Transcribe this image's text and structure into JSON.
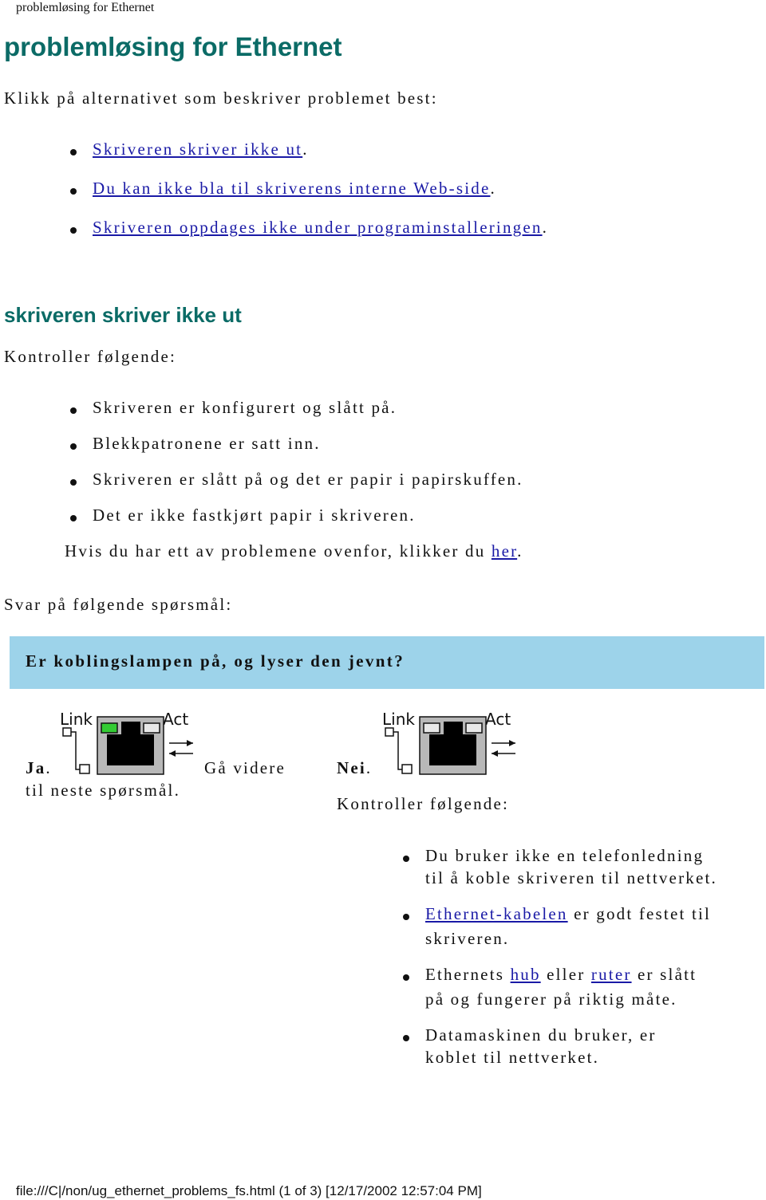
{
  "page_header": "problemløsing for Ethernet",
  "title": "problemløsing for Ethernet",
  "intro": "Klikk på alternativet som beskriver problemet best:",
  "problem_links": [
    {
      "label": "Skriveren skriver ikke ut",
      "suffix": "."
    },
    {
      "label": "Du kan ikke bla til skriverens interne Web-side",
      "suffix": "."
    },
    {
      "label": "Skriveren oppdages ikke under programinstalleringen",
      "suffix": "."
    }
  ],
  "section1": {
    "heading": "skriveren skriver ikke ut",
    "check_intro": "Kontroller følgende:",
    "checks": [
      "Skriveren er konfigurert og slått på.",
      "Blekkpatronene er satt inn.",
      "Skriveren er slått på og det er papir i papirskuffen.",
      "Det er ikke fastkjørt papir i skriveren."
    ],
    "help_prefix": "Hvis du har ett av problemene ovenfor, klikker du ",
    "help_link": "her",
    "help_suffix": ".",
    "answer_prompt": "Svar på følgende spørsmål:",
    "question": "Er koblingslampen på, og lyser den jevnt?"
  },
  "yes_answer": {
    "label": "Ja",
    "label_suffix": ".",
    "text_line1": "Gå videre",
    "text_line2": "til neste spørsmål.",
    "icon": {
      "name": "ethernet-port-link-on-icon",
      "link_label": "Link",
      "act_label": "Act",
      "link_led_color": "#33cc33",
      "act_led_color": "#e8e8e8"
    }
  },
  "no_answer": {
    "label": "Nei",
    "label_suffix": ".",
    "check_intro": "Kontroller følgende:",
    "icon": {
      "name": "ethernet-port-link-off-icon",
      "link_label": "Link",
      "act_label": "Act",
      "link_led_color": "#e8e8e8",
      "act_led_color": "#e8e8e8"
    },
    "checks": [
      {
        "parts": [
          {
            "text": "Du bruker ikke en telefonledning"
          }
        ],
        "line2": "til å koble skriveren til nettverket."
      },
      {
        "parts": [
          {
            "text": "Ethernet-kabelen",
            "link": true
          },
          {
            "text": " er godt festet til"
          }
        ],
        "line2": "skriveren."
      },
      {
        "parts": [
          {
            "text": "Ethernets "
          },
          {
            "text": "hub",
            "link": true
          },
          {
            "text": " eller "
          },
          {
            "text": "ruter",
            "link": true
          },
          {
            "text": " er slått"
          }
        ],
        "line2": "på og fungerer på riktig måte."
      },
      {
        "parts": [
          {
            "text": "Datamaskinen du bruker, er"
          }
        ],
        "line2": "koblet til nettverket."
      }
    ]
  },
  "footer": "file:///C|/non/ug_ethernet_problems_fs.html (1 of 3) [12/17/2002 12:57:04 PM]",
  "colors": {
    "heading": "#0b6b66",
    "link": "#1a1aa6",
    "question_bar": "#9dd3ea"
  }
}
